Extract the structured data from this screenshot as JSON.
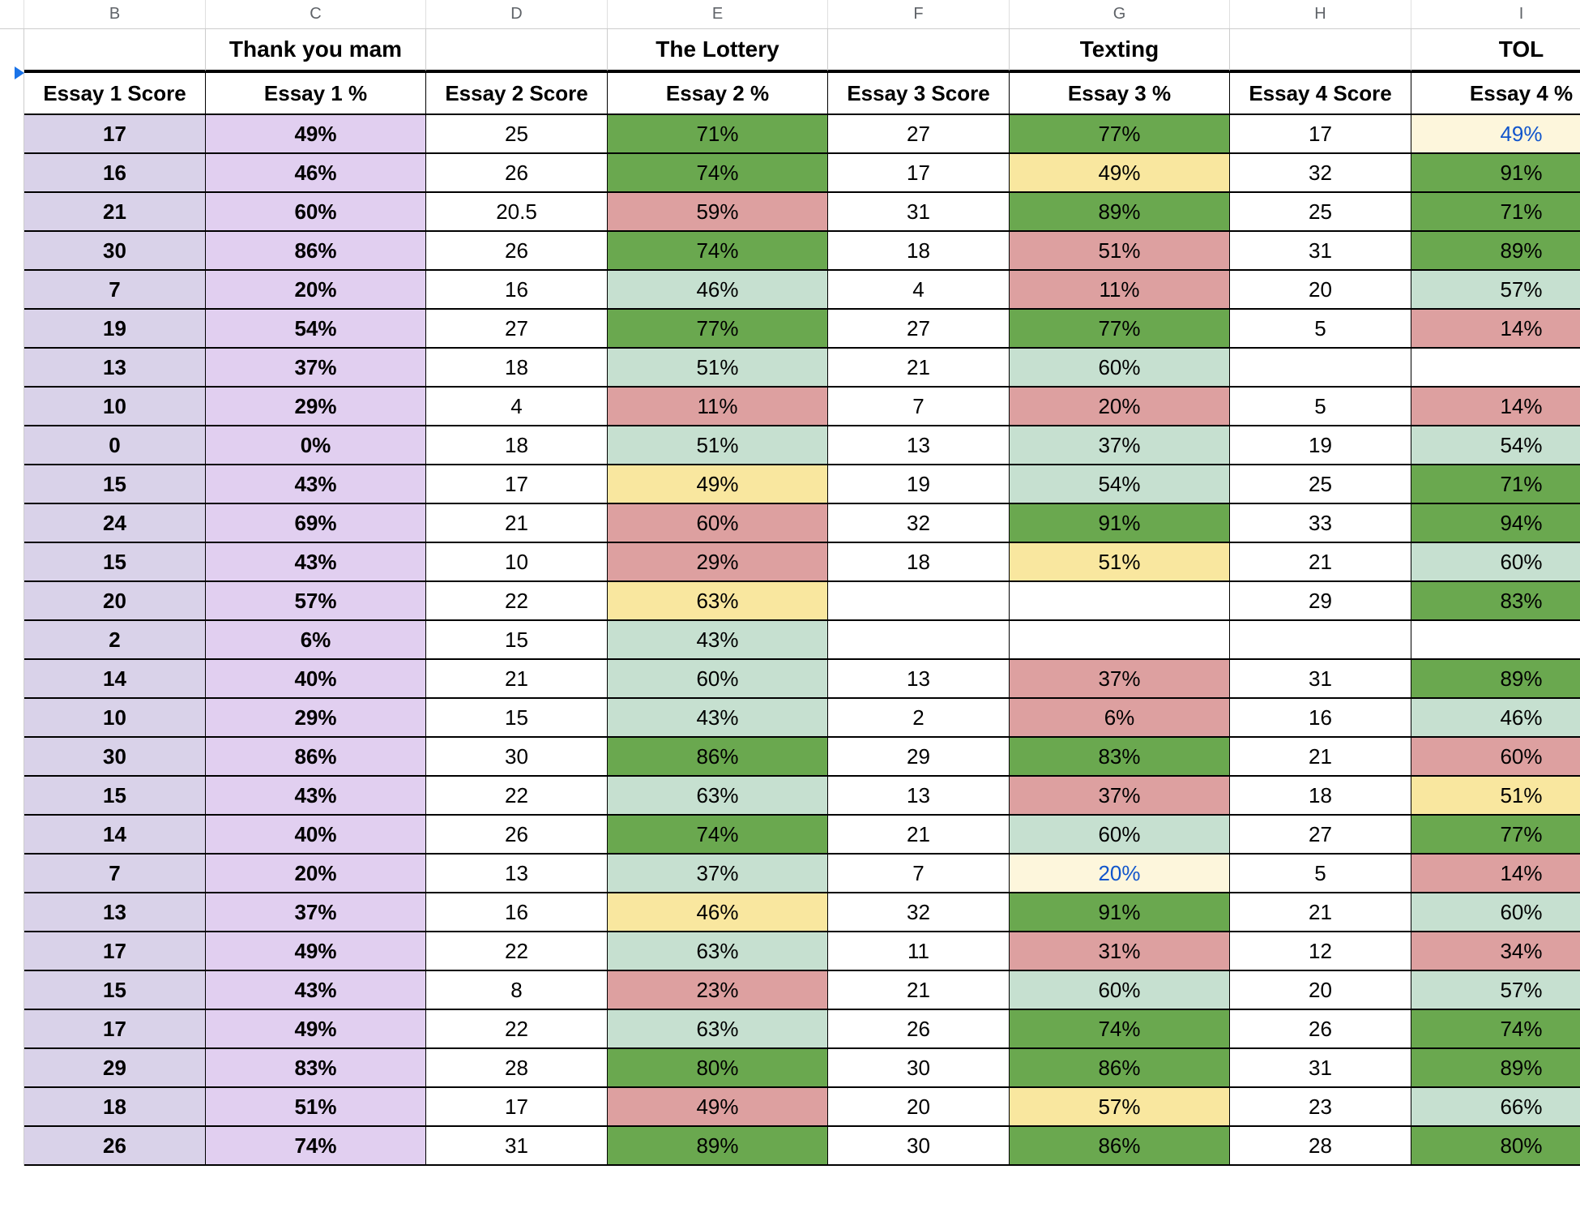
{
  "columns": [
    "B",
    "C",
    "D",
    "E",
    "F",
    "G",
    "H",
    "I"
  ],
  "title_row": {
    "C": "Thank you mam",
    "E": "The Lottery",
    "G": "Texting",
    "I": "TOL"
  },
  "headers": {
    "B": "Essay 1 Score",
    "C": "Essay 1 %",
    "D": "Essay 2 Score",
    "E": "Essay 2 %",
    "F": "Essay 3 Score",
    "G": "Essay 3 %",
    "H": "Essay 4 Score",
    "I": "Essay 4 %"
  },
  "rows": [
    {
      "B": {
        "v": "17",
        "c": "bg-lav-light bold"
      },
      "C": {
        "v": "49%",
        "c": "bg-lav bold"
      },
      "D": {
        "v": "25"
      },
      "E": {
        "v": "71%",
        "c": "bg-green-dark"
      },
      "F": {
        "v": "27"
      },
      "G": {
        "v": "77%",
        "c": "bg-green-dark"
      },
      "H": {
        "v": "17"
      },
      "I": {
        "v": "49%",
        "c": "bg-yellow-pale txt-blue"
      }
    },
    {
      "B": {
        "v": "16",
        "c": "bg-lav-light bold"
      },
      "C": {
        "v": "46%",
        "c": "bg-lav bold"
      },
      "D": {
        "v": "26"
      },
      "E": {
        "v": "74%",
        "c": "bg-green-dark"
      },
      "F": {
        "v": "17"
      },
      "G": {
        "v": "49%",
        "c": "bg-yellow"
      },
      "H": {
        "v": "32"
      },
      "I": {
        "v": "91%",
        "c": "bg-green-dark"
      }
    },
    {
      "B": {
        "v": "21",
        "c": "bg-lav-light bold"
      },
      "C": {
        "v": "60%",
        "c": "bg-lav bold"
      },
      "D": {
        "v": "20.5"
      },
      "E": {
        "v": "59%",
        "c": "bg-red"
      },
      "F": {
        "v": "31"
      },
      "G": {
        "v": "89%",
        "c": "bg-green-dark"
      },
      "H": {
        "v": "25"
      },
      "I": {
        "v": "71%",
        "c": "bg-green-dark"
      }
    },
    {
      "B": {
        "v": "30",
        "c": "bg-lav-light bold"
      },
      "C": {
        "v": "86%",
        "c": "bg-lav bold"
      },
      "D": {
        "v": "26"
      },
      "E": {
        "v": "74%",
        "c": "bg-green-dark"
      },
      "F": {
        "v": "18"
      },
      "G": {
        "v": "51%",
        "c": "bg-red"
      },
      "H": {
        "v": "31"
      },
      "I": {
        "v": "89%",
        "c": "bg-green-dark"
      }
    },
    {
      "B": {
        "v": "7",
        "c": "bg-lav-light bold"
      },
      "C": {
        "v": "20%",
        "c": "bg-lav bold"
      },
      "D": {
        "v": "16"
      },
      "E": {
        "v": "46%",
        "c": "bg-green-light"
      },
      "F": {
        "v": "4"
      },
      "G": {
        "v": "11%",
        "c": "bg-red"
      },
      "H": {
        "v": "20"
      },
      "I": {
        "v": "57%",
        "c": "bg-green-light"
      }
    },
    {
      "B": {
        "v": "19",
        "c": "bg-lav-light bold"
      },
      "C": {
        "v": "54%",
        "c": "bg-lav bold"
      },
      "D": {
        "v": "27"
      },
      "E": {
        "v": "77%",
        "c": "bg-green-dark"
      },
      "F": {
        "v": "27"
      },
      "G": {
        "v": "77%",
        "c": "bg-green-dark"
      },
      "H": {
        "v": "5"
      },
      "I": {
        "v": "14%",
        "c": "bg-red"
      }
    },
    {
      "B": {
        "v": "13",
        "c": "bg-lav-light bold"
      },
      "C": {
        "v": "37%",
        "c": "bg-lav bold"
      },
      "D": {
        "v": "18"
      },
      "E": {
        "v": "51%",
        "c": "bg-green-light"
      },
      "F": {
        "v": "21"
      },
      "G": {
        "v": "60%",
        "c": "bg-green-light"
      },
      "H": {
        "v": ""
      },
      "I": {
        "v": ""
      }
    },
    {
      "B": {
        "v": "10",
        "c": "bg-lav-light bold"
      },
      "C": {
        "v": "29%",
        "c": "bg-lav bold"
      },
      "D": {
        "v": "4"
      },
      "E": {
        "v": "11%",
        "c": "bg-red"
      },
      "F": {
        "v": "7"
      },
      "G": {
        "v": "20%",
        "c": "bg-red"
      },
      "H": {
        "v": "5"
      },
      "I": {
        "v": "14%",
        "c": "bg-red"
      }
    },
    {
      "B": {
        "v": "0",
        "c": "bg-lav-light bold"
      },
      "C": {
        "v": "0%",
        "c": "bg-lav bold"
      },
      "D": {
        "v": "18"
      },
      "E": {
        "v": "51%",
        "c": "bg-green-light"
      },
      "F": {
        "v": "13"
      },
      "G": {
        "v": "37%",
        "c": "bg-green-light"
      },
      "H": {
        "v": "19"
      },
      "I": {
        "v": "54%",
        "c": "bg-green-light"
      }
    },
    {
      "B": {
        "v": "15",
        "c": "bg-lav-light bold"
      },
      "C": {
        "v": "43%",
        "c": "bg-lav bold"
      },
      "D": {
        "v": "17"
      },
      "E": {
        "v": "49%",
        "c": "bg-yellow"
      },
      "F": {
        "v": "19"
      },
      "G": {
        "v": "54%",
        "c": "bg-green-light"
      },
      "H": {
        "v": "25"
      },
      "I": {
        "v": "71%",
        "c": "bg-green-dark"
      }
    },
    {
      "B": {
        "v": "24",
        "c": "bg-lav-light bold"
      },
      "C": {
        "v": "69%",
        "c": "bg-lav bold"
      },
      "D": {
        "v": "21"
      },
      "E": {
        "v": "60%",
        "c": "bg-red"
      },
      "F": {
        "v": "32"
      },
      "G": {
        "v": "91%",
        "c": "bg-green-dark"
      },
      "H": {
        "v": "33"
      },
      "I": {
        "v": "94%",
        "c": "bg-green-dark"
      }
    },
    {
      "B": {
        "v": "15",
        "c": "bg-lav-light bold"
      },
      "C": {
        "v": "43%",
        "c": "bg-lav bold"
      },
      "D": {
        "v": "10"
      },
      "E": {
        "v": "29%",
        "c": "bg-red"
      },
      "F": {
        "v": "18"
      },
      "G": {
        "v": "51%",
        "c": "bg-yellow"
      },
      "H": {
        "v": "21"
      },
      "I": {
        "v": "60%",
        "c": "bg-green-light"
      }
    },
    {
      "B": {
        "v": "20",
        "c": "bg-lav-light bold"
      },
      "C": {
        "v": "57%",
        "c": "bg-lav bold"
      },
      "D": {
        "v": "22"
      },
      "E": {
        "v": "63%",
        "c": "bg-yellow"
      },
      "F": {
        "v": ""
      },
      "G": {
        "v": ""
      },
      "H": {
        "v": "29"
      },
      "I": {
        "v": "83%",
        "c": "bg-green-dark"
      }
    },
    {
      "B": {
        "v": "2",
        "c": "bg-lav-light bold"
      },
      "C": {
        "v": "6%",
        "c": "bg-lav bold"
      },
      "D": {
        "v": "15"
      },
      "E": {
        "v": "43%",
        "c": "bg-green-light"
      },
      "F": {
        "v": ""
      },
      "G": {
        "v": ""
      },
      "H": {
        "v": ""
      },
      "I": {
        "v": ""
      }
    },
    {
      "B": {
        "v": "14",
        "c": "bg-lav-light bold"
      },
      "C": {
        "v": "40%",
        "c": "bg-lav bold"
      },
      "D": {
        "v": "21"
      },
      "E": {
        "v": "60%",
        "c": "bg-green-light"
      },
      "F": {
        "v": "13"
      },
      "G": {
        "v": "37%",
        "c": "bg-red"
      },
      "H": {
        "v": "31"
      },
      "I": {
        "v": "89%",
        "c": "bg-green-dark"
      }
    },
    {
      "B": {
        "v": "10",
        "c": "bg-lav-light bold"
      },
      "C": {
        "v": "29%",
        "c": "bg-lav bold"
      },
      "D": {
        "v": "15"
      },
      "E": {
        "v": "43%",
        "c": "bg-green-light"
      },
      "F": {
        "v": "2"
      },
      "G": {
        "v": "6%",
        "c": "bg-red"
      },
      "H": {
        "v": "16"
      },
      "I": {
        "v": "46%",
        "c": "bg-green-light"
      }
    },
    {
      "B": {
        "v": "30",
        "c": "bg-lav-light bold"
      },
      "C": {
        "v": "86%",
        "c": "bg-lav bold"
      },
      "D": {
        "v": "30"
      },
      "E": {
        "v": "86%",
        "c": "bg-green-dark"
      },
      "F": {
        "v": "29"
      },
      "G": {
        "v": "83%",
        "c": "bg-green-dark"
      },
      "H": {
        "v": "21"
      },
      "I": {
        "v": "60%",
        "c": "bg-red"
      }
    },
    {
      "B": {
        "v": "15",
        "c": "bg-lav-light bold"
      },
      "C": {
        "v": "43%",
        "c": "bg-lav bold"
      },
      "D": {
        "v": "22"
      },
      "E": {
        "v": "63%",
        "c": "bg-green-light"
      },
      "F": {
        "v": "13"
      },
      "G": {
        "v": "37%",
        "c": "bg-red"
      },
      "H": {
        "v": "18"
      },
      "I": {
        "v": "51%",
        "c": "bg-yellow"
      }
    },
    {
      "B": {
        "v": "14",
        "c": "bg-lav-light bold"
      },
      "C": {
        "v": "40%",
        "c": "bg-lav bold"
      },
      "D": {
        "v": "26"
      },
      "E": {
        "v": "74%",
        "c": "bg-green-dark"
      },
      "F": {
        "v": "21"
      },
      "G": {
        "v": "60%",
        "c": "bg-green-light"
      },
      "H": {
        "v": "27"
      },
      "I": {
        "v": "77%",
        "c": "bg-green-dark"
      }
    },
    {
      "B": {
        "v": "7",
        "c": "bg-lav-light bold"
      },
      "C": {
        "v": "20%",
        "c": "bg-lav bold"
      },
      "D": {
        "v": "13"
      },
      "E": {
        "v": "37%",
        "c": "bg-green-light"
      },
      "F": {
        "v": "7"
      },
      "G": {
        "v": "20%",
        "c": "bg-yellow-pale txt-blue"
      },
      "H": {
        "v": "5"
      },
      "I": {
        "v": "14%",
        "c": "bg-red"
      }
    },
    {
      "B": {
        "v": "13",
        "c": "bg-lav-light bold"
      },
      "C": {
        "v": "37%",
        "c": "bg-lav bold"
      },
      "D": {
        "v": "16"
      },
      "E": {
        "v": "46%",
        "c": "bg-yellow"
      },
      "F": {
        "v": "32"
      },
      "G": {
        "v": "91%",
        "c": "bg-green-dark"
      },
      "H": {
        "v": "21"
      },
      "I": {
        "v": "60%",
        "c": "bg-green-light"
      }
    },
    {
      "B": {
        "v": "17",
        "c": "bg-lav-light bold"
      },
      "C": {
        "v": "49%",
        "c": "bg-lav bold"
      },
      "D": {
        "v": "22"
      },
      "E": {
        "v": "63%",
        "c": "bg-green-light"
      },
      "F": {
        "v": "11"
      },
      "G": {
        "v": "31%",
        "c": "bg-red"
      },
      "H": {
        "v": "12"
      },
      "I": {
        "v": "34%",
        "c": "bg-red"
      }
    },
    {
      "B": {
        "v": "15",
        "c": "bg-lav-light bold"
      },
      "C": {
        "v": "43%",
        "c": "bg-lav bold"
      },
      "D": {
        "v": "8"
      },
      "E": {
        "v": "23%",
        "c": "bg-red"
      },
      "F": {
        "v": "21"
      },
      "G": {
        "v": "60%",
        "c": "bg-green-light"
      },
      "H": {
        "v": "20"
      },
      "I": {
        "v": "57%",
        "c": "bg-green-light"
      }
    },
    {
      "B": {
        "v": "17",
        "c": "bg-lav-light bold"
      },
      "C": {
        "v": "49%",
        "c": "bg-lav bold"
      },
      "D": {
        "v": "22"
      },
      "E": {
        "v": "63%",
        "c": "bg-green-light"
      },
      "F": {
        "v": "26"
      },
      "G": {
        "v": "74%",
        "c": "bg-green-dark"
      },
      "H": {
        "v": "26"
      },
      "I": {
        "v": "74%",
        "c": "bg-green-dark"
      }
    },
    {
      "B": {
        "v": "29",
        "c": "bg-lav-light bold"
      },
      "C": {
        "v": "83%",
        "c": "bg-lav bold"
      },
      "D": {
        "v": "28"
      },
      "E": {
        "v": "80%",
        "c": "bg-green-dark"
      },
      "F": {
        "v": "30"
      },
      "G": {
        "v": "86%",
        "c": "bg-green-dark"
      },
      "H": {
        "v": "31"
      },
      "I": {
        "v": "89%",
        "c": "bg-green-dark"
      }
    },
    {
      "B": {
        "v": "18",
        "c": "bg-lav-light bold"
      },
      "C": {
        "v": "51%",
        "c": "bg-lav bold"
      },
      "D": {
        "v": "17"
      },
      "E": {
        "v": "49%",
        "c": "bg-red"
      },
      "F": {
        "v": "20"
      },
      "G": {
        "v": "57%",
        "c": "bg-yellow"
      },
      "H": {
        "v": "23"
      },
      "I": {
        "v": "66%",
        "c": "bg-green-light"
      }
    },
    {
      "B": {
        "v": "26",
        "c": "bg-lav-light bold"
      },
      "C": {
        "v": "74%",
        "c": "bg-lav bold"
      },
      "D": {
        "v": "31"
      },
      "E": {
        "v": "89%",
        "c": "bg-green-dark"
      },
      "F": {
        "v": "30"
      },
      "G": {
        "v": "86%",
        "c": "bg-green-dark"
      },
      "H": {
        "v": "28"
      },
      "I": {
        "v": "80%",
        "c": "bg-green-dark"
      }
    }
  ]
}
